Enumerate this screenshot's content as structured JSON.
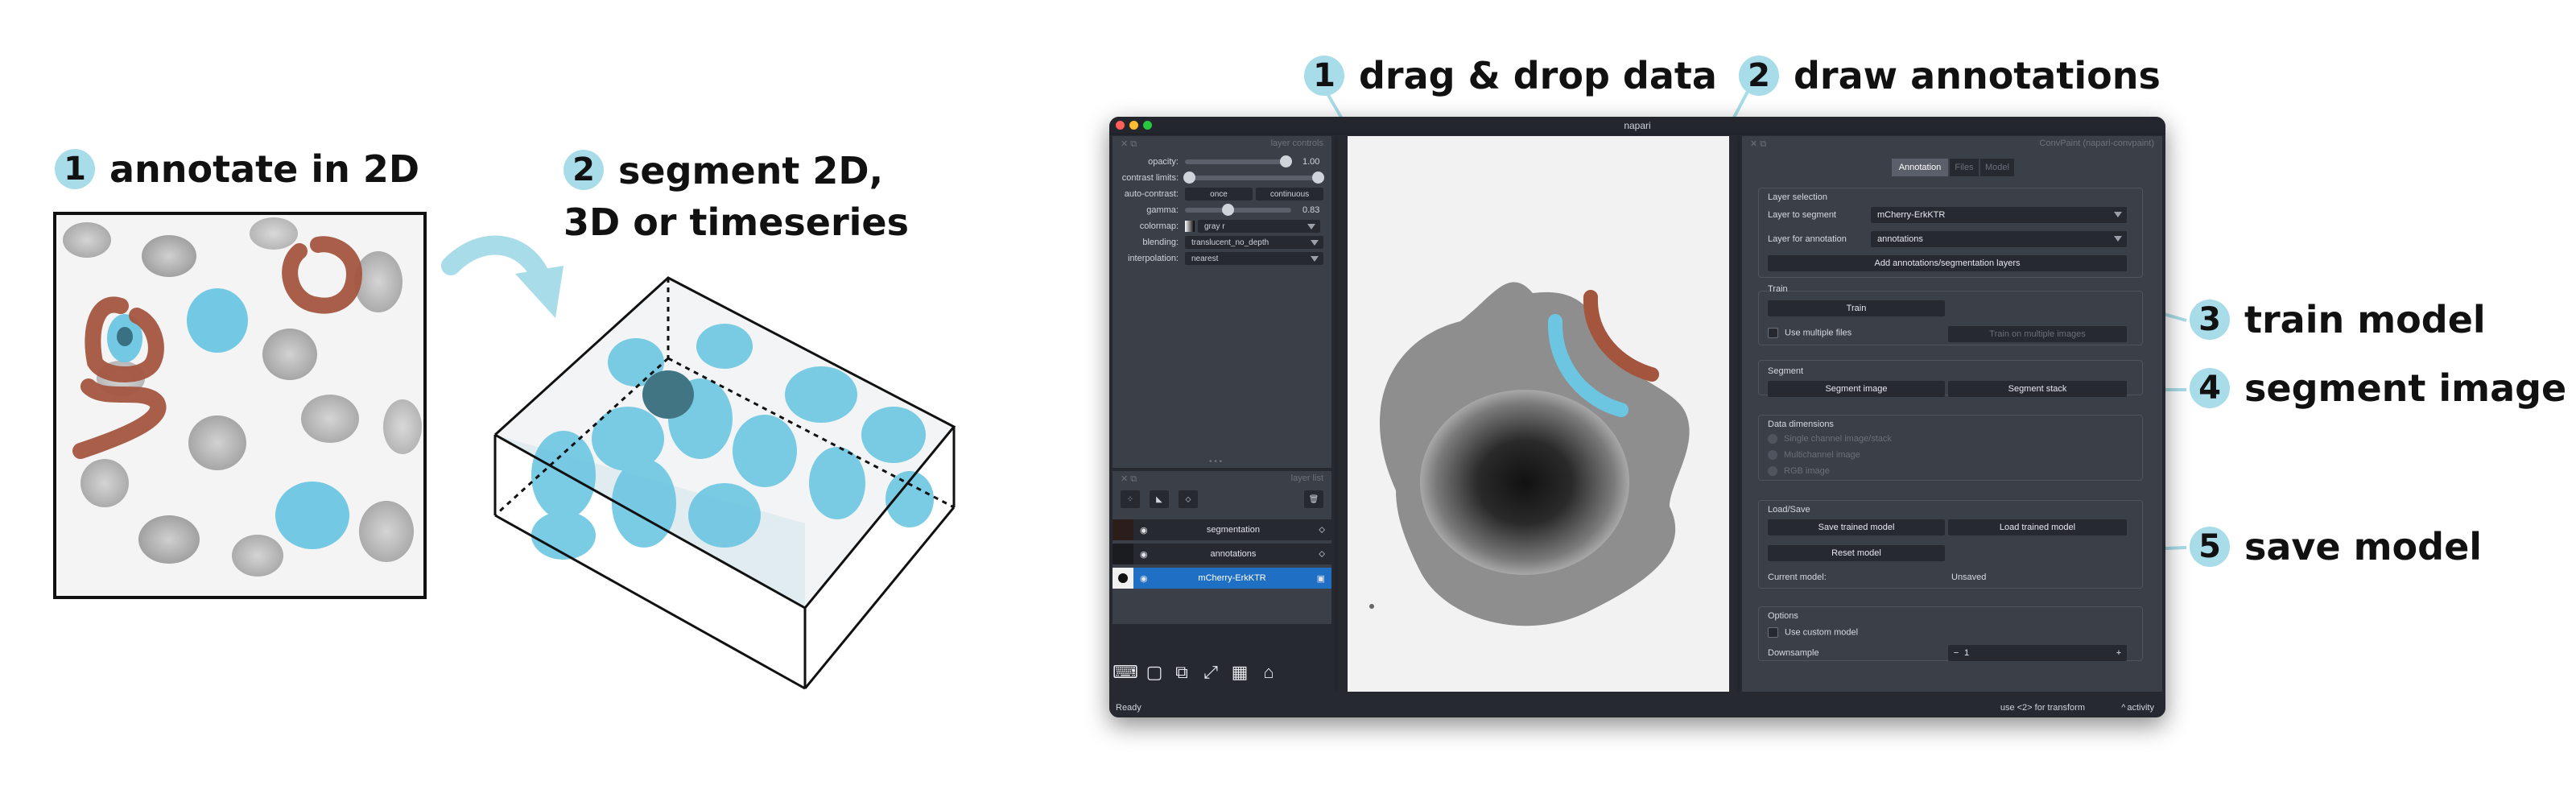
{
  "steps_left": [
    {
      "num": "1",
      "label": "annotate in 2D"
    },
    {
      "num": "2",
      "label_line1": "segment 2D,",
      "label_line2": "3D or timeseries"
    }
  ],
  "steps_top": [
    {
      "num": "1",
      "label": "drag & drop data"
    },
    {
      "num": "2",
      "label": "draw annotations"
    }
  ],
  "steps_right": [
    {
      "num": "3",
      "label": "train model"
    },
    {
      "num": "4",
      "label": "segment image"
    },
    {
      "num": "5",
      "label": "save model"
    }
  ],
  "colors": {
    "annotation_brown": "#a3553e",
    "segmentation_cyan": "#6cc6e2",
    "accent_circle": "#a8dce8",
    "window_bg": "#262930",
    "panel_bg": "#3b3f48",
    "selected_blue": "#1f6fc4"
  },
  "window": {
    "title": "napari",
    "left_dock_title": "layer controls",
    "right_dock_title": "ConvPaint (napari-convpaint)",
    "layer_list_title": "layer list"
  },
  "layer_controls": {
    "opacity_label": "opacity:",
    "opacity_value": "1.00",
    "contrast_label": "contrast limits:",
    "autocontrast_label": "auto-contrast:",
    "autocontrast_once": "once",
    "autocontrast_continuous": "continuous",
    "gamma_label": "gamma:",
    "gamma_value": "0.83",
    "colormap_label": "colormap:",
    "colormap_value": "gray r",
    "blending_label": "blending:",
    "blending_value": "translucent_no_depth",
    "interpolation_label": "interpolation:",
    "interpolation_value": "nearest"
  },
  "layers": [
    {
      "name": "segmentation",
      "selected": false
    },
    {
      "name": "annotations",
      "selected": false
    },
    {
      "name": "mCherry-ErkKTR",
      "selected": true
    }
  ],
  "plugin": {
    "tabs": [
      "Annotation",
      "Files",
      "Model"
    ],
    "layer_selection": {
      "title": "Layer selection",
      "segment_label": "Layer to segment",
      "segment_value": "mCherry-ErkKTR",
      "annotation_label": "Layer for annotation",
      "annotation_value": "annotations",
      "add_button": "Add annotations/segmentation layers"
    },
    "train": {
      "title": "Train",
      "train_button": "Train",
      "multiple_files": "Use multiple files",
      "train_multiple": "Train on multiple images"
    },
    "segment": {
      "title": "Segment",
      "segment_image": "Segment image",
      "segment_stack": "Segment stack"
    },
    "data_dimensions": {
      "title": "Data dimensions",
      "options": [
        "Single channel image/stack",
        "Multichannel image",
        "RGB image"
      ]
    },
    "load_save": {
      "title": "Load/Save",
      "save": "Save trained model",
      "load": "Load trained model",
      "reset": "Reset model",
      "current_label": "Current model:",
      "current_value": "Unsaved"
    },
    "options": {
      "title": "Options",
      "custom_model": "Use custom model",
      "downsample_label": "Downsample",
      "downsample_value": "1",
      "minus": "−",
      "plus": "+"
    }
  },
  "statusbar": {
    "left": "Ready",
    "hint": "use <2> for transform",
    "activity": "activity"
  }
}
